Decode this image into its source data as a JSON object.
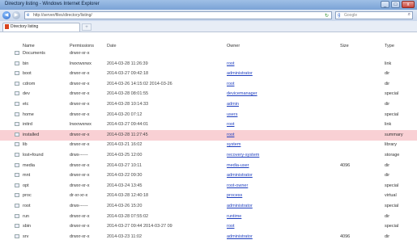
{
  "window": {
    "title": "Directory listing - Windows Internet Explorer",
    "buttons": {
      "minimize": "_",
      "maximize": "□",
      "close": "x"
    }
  },
  "address_bar": {
    "url": "http://server/files/directory/listing/",
    "search_placeholder": "Google"
  },
  "tab": {
    "label": "Directory listing"
  },
  "table": {
    "headers": [
      "Name",
      "Permissions",
      "Date",
      "Owner",
      "Size",
      "Type"
    ],
    "rows": [
      {
        "name": "Documents",
        "perm": "drwxr-xr-x",
        "date": "",
        "owner": "",
        "size": "",
        "type": ""
      },
      {
        "name": "bin",
        "perm": "lrwxrwxrwx",
        "date": "2014-03-28 11:26:39",
        "owner": "root",
        "size": "",
        "type": "link"
      },
      {
        "name": "boot",
        "perm": "drwxr-xr-x",
        "date": "2014-03-27 09:42:18",
        "owner": "administrator",
        "size": "",
        "type": "dir"
      },
      {
        "name": "cdrom",
        "perm": "drwxr-xr-x",
        "date": "2014-03-26 14:15:02 2014-03-26",
        "owner": "root",
        "size": "",
        "type": "dir"
      },
      {
        "name": "dev",
        "perm": "drwxr-xr-x",
        "date": "2014-03-28 08:01:55",
        "owner": "devicemanager",
        "size": "",
        "type": "special"
      },
      {
        "name": "etc",
        "perm": "drwxr-xr-x",
        "date": "2014-03-28 10:14:33",
        "owner": "admin",
        "size": "",
        "type": "dir"
      },
      {
        "name": "home",
        "perm": "drwxr-xr-x",
        "date": "2014-03-20 07:12",
        "owner": "users",
        "size": "",
        "type": "special"
      },
      {
        "name": "initrd",
        "perm": "lrwxrwxrwx",
        "date": "2014-03-27 09:44:01",
        "owner": "root",
        "size": "",
        "type": "link"
      },
      {
        "name": "installed",
        "perm": "drwxr-xr-x",
        "date": "2014-03-28 11:27:45",
        "owner": "root",
        "size": "",
        "type": "summary"
      },
      {
        "name": "lib",
        "perm": "drwxr-xr-x",
        "date": "2014-03-21 16:02",
        "owner": "system",
        "size": "",
        "type": "library"
      },
      {
        "name": "lost+found",
        "perm": "drwx------",
        "date": "2014-03-25 12:00",
        "owner": "recovery-system",
        "size": "",
        "type": "storage"
      },
      {
        "name": "media",
        "perm": "drwxr-xr-x",
        "date": "2014-03-27 10:11",
        "owner": "media-user",
        "size": "4096",
        "type": "dir"
      },
      {
        "name": "mnt",
        "perm": "drwxr-xr-x",
        "date": "2014-03-22 09:30",
        "owner": "administrator",
        "size": "",
        "type": "dir"
      },
      {
        "name": "opt",
        "perm": "drwxr-xr-x",
        "date": "2014-03-24 13:45",
        "owner": "root-owner",
        "size": "",
        "type": "special"
      },
      {
        "name": "proc",
        "perm": "dr-xr-xr-x",
        "date": "2014-03-28 12:40:18",
        "owner": "process",
        "size": "",
        "type": "virtual"
      },
      {
        "name": "root",
        "perm": "drwx------",
        "date": "2014-03-26 15:20",
        "owner": "administrator",
        "size": "",
        "type": "special"
      },
      {
        "name": "run",
        "perm": "drwxr-xr-x",
        "date": "2014-03-28 07:55:02",
        "owner": "runtime",
        "size": "",
        "type": "dir"
      },
      {
        "name": "sbin",
        "perm": "drwxr-xr-x",
        "date": "2014-03-27 09:44 2014-03-27 09",
        "owner": "root",
        "size": "",
        "type": "special"
      },
      {
        "name": "srv",
        "perm": "drwxr-xr-x",
        "date": "2014-03-23 11:02",
        "owner": "administrator",
        "size": "4096",
        "type": "dir"
      }
    ]
  }
}
